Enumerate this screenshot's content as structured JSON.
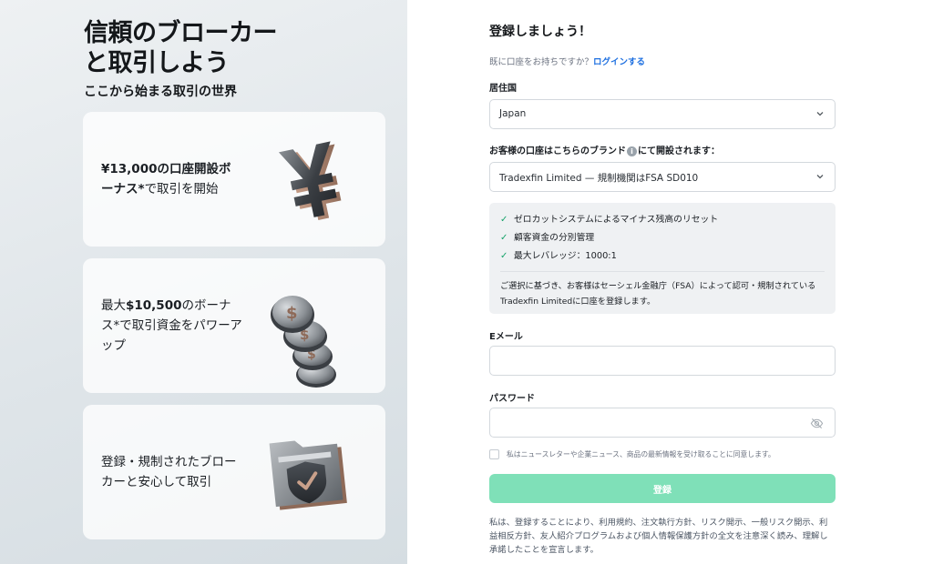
{
  "hero": {
    "title": "信頼のブローカーと取引しよう",
    "subtitle": "ここから始まる取引の世界"
  },
  "cards": [
    {
      "text_bold": "¥13,000の口座開設ボーナス*",
      "text_rest": "で取引を開始",
      "icon": "yen-icon"
    },
    {
      "text_pre": "最大",
      "text_bold": "$10,500",
      "text_rest": "のボーナス*で取引資金をパワーアップ",
      "icon": "dollar-coins-icon"
    },
    {
      "text_rest": "登録・規制されたブローカーと安心して取引",
      "icon": "shield-folder-icon"
    }
  ],
  "form": {
    "title": "登録しましょう！",
    "login_prompt": "既に口座をお持ちですか？",
    "login_link": "ログインする",
    "country_label": "居住国",
    "country_value": "Japan",
    "brand_label_pre": "お客様の口座はこちらのブランド",
    "brand_label_post": "にて開設されます：",
    "brand_value": "Tradexfin Limited — 規制機関はFSA SD010",
    "features": [
      "ゼロカットシステムによるマイナス残高のリセット",
      "顧客資金の分別管理",
      "最大レバレッジ：1000:1"
    ],
    "reg_note": "ご選択に基づき、お客様はセーシェル金融庁（FSA）によって認可・規制されているTradexfin Limitedに口座を登録します。",
    "email_label": "Eメール",
    "password_label": "パスワード",
    "consent": "私はニュースレターや企業ニュース、商品の最新情報を受け取ることに同意します。",
    "submit_label": "登録",
    "terms": "私は、登録することにより、利用規約、注文執行方針、リスク開示、一般リスク開示、利益相反方針、友人紹介プログラムおよび個人情報保護方針の全文を注意深く読み、理解し承諾したことを宣言します。"
  },
  "colors": {
    "accent_link": "#1d6fe0",
    "submit_bg": "#7fe0b8",
    "check": "#18a36b"
  }
}
